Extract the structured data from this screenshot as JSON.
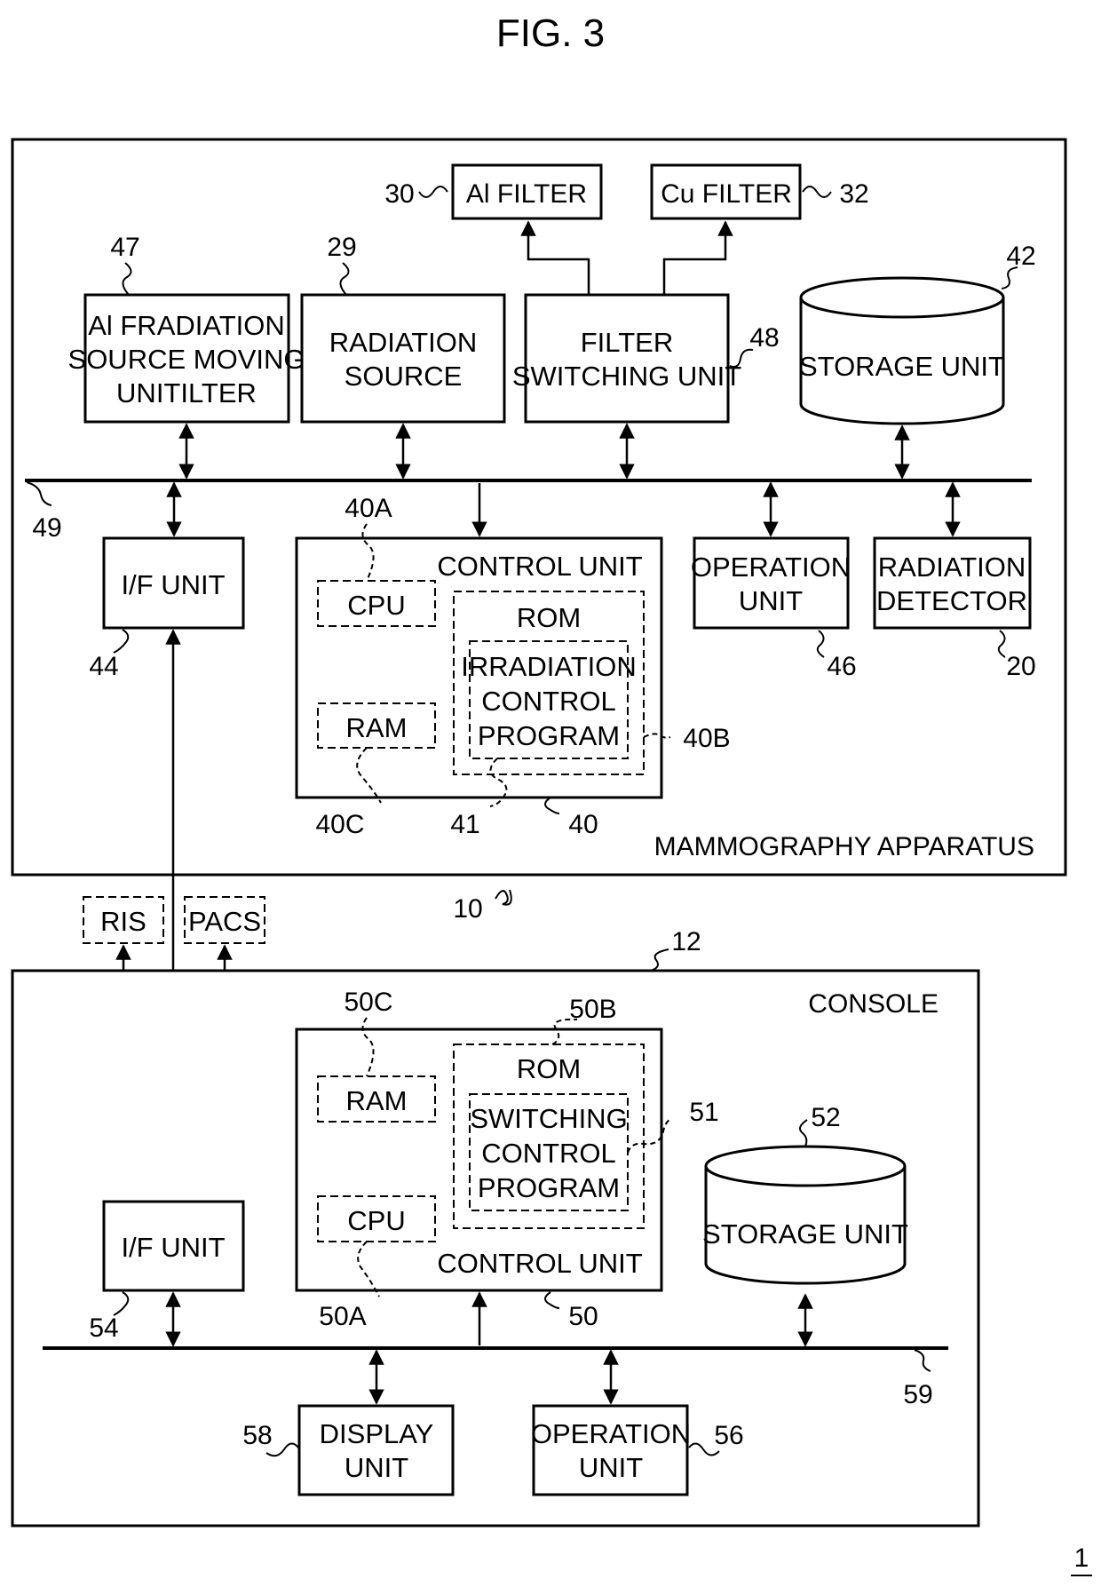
{
  "figure": {
    "title": "FIG. 3",
    "system_ref": "1"
  },
  "mammography": {
    "label": "MAMMOGRAPHY APPARATUS",
    "ref": "10",
    "bus_ref": "49",
    "al_filter": {
      "label": "Al FILTER",
      "ref": "30"
    },
    "cu_filter": {
      "label": "Cu FILTER",
      "ref": "32"
    },
    "source_moving": {
      "lines": [
        "Al FRADIATION",
        "SOURCE MOVING",
        "UNITILTER"
      ],
      "ref": "47"
    },
    "radiation_source": {
      "lines": [
        "RADIATION",
        "SOURCE"
      ],
      "ref": "29"
    },
    "filter_switching": {
      "lines": [
        "FILTER",
        "SWITCHING UNIT"
      ],
      "ref": "48"
    },
    "storage": {
      "label": "STORAGE UNIT",
      "ref": "42"
    },
    "if_unit": {
      "label": "I/F UNIT",
      "ref": "44"
    },
    "control_unit": {
      "label": "CONTROL UNIT",
      "ref": "40",
      "cpu": {
        "label": "CPU",
        "ref": "40A"
      },
      "ram": {
        "label": "RAM",
        "ref": "40C"
      },
      "rom": {
        "label": "ROM",
        "ref": "40B"
      },
      "program": {
        "lines": [
          "IRRADIATION",
          "CONTROL",
          "PROGRAM"
        ],
        "ref": "41"
      }
    },
    "operation_unit": {
      "lines": [
        "OPERATION",
        "UNIT"
      ],
      "ref": "46"
    },
    "radiation_detector": {
      "lines": [
        "RADIATION",
        "DETECTOR"
      ],
      "ref": "20"
    }
  },
  "external": {
    "ris": "RIS",
    "pacs": "PACS"
  },
  "console": {
    "label": "CONSOLE",
    "ref": "12",
    "bus_ref": "59",
    "if_unit": {
      "label": "I/F UNIT",
      "ref": "54"
    },
    "control_unit": {
      "label": "CONTROL UNIT",
      "ref": "50",
      "cpu": {
        "label": "CPU",
        "ref": "50A"
      },
      "ram": {
        "label": "RAM",
        "ref": "50C"
      },
      "rom": {
        "label": "ROM",
        "ref": "50B"
      },
      "program": {
        "lines": [
          "SWITCHING",
          "CONTROL",
          "PROGRAM"
        ],
        "ref": "51"
      }
    },
    "storage": {
      "label": "STORAGE UNIT",
      "ref": "52"
    },
    "display_unit": {
      "lines": [
        "DISPLAY",
        "UNIT"
      ],
      "ref": "58"
    },
    "operation_unit": {
      "lines": [
        "OPERATION",
        "UNIT"
      ],
      "ref": "56"
    }
  }
}
